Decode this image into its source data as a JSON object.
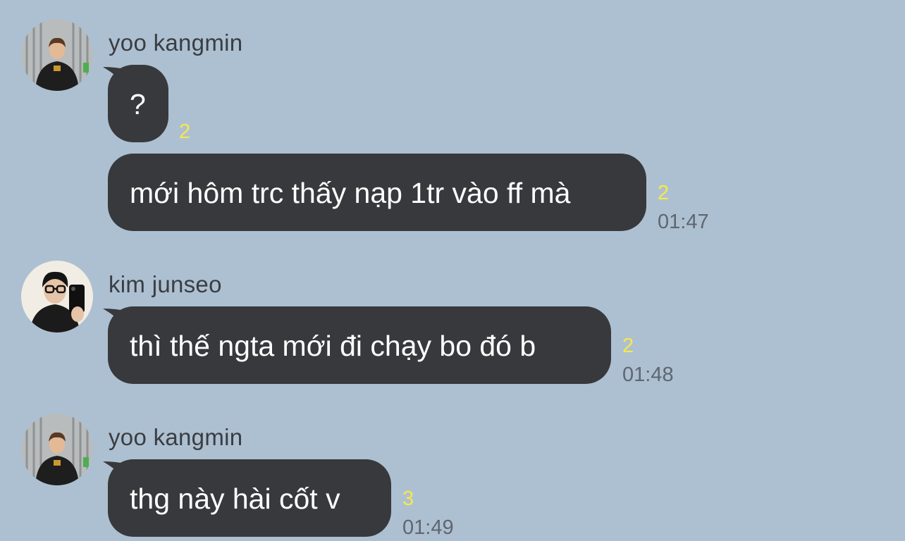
{
  "colors": {
    "background": "#adc0d1",
    "bubble": "#38393c",
    "bubble_text": "#ffffff",
    "unread": "#f7e84a",
    "time": "#5f6670",
    "sender": "#3a3d42"
  },
  "messages": [
    {
      "sender": "yoo kangmin",
      "avatar": "profile-photo",
      "bubbles": [
        {
          "text": "?",
          "unread": "2",
          "time": ""
        },
        {
          "text": "mới hôm trc thấy nạp 1tr vào ff mà",
          "unread": "2",
          "time": "01:47"
        }
      ]
    },
    {
      "sender": "kim junseo",
      "avatar": "profile-photo",
      "bubbles": [
        {
          "text": "thì thế ngta mới đi chạy bo đó b",
          "unread": "2",
          "time": "01:48"
        }
      ]
    },
    {
      "sender": "yoo kangmin",
      "avatar": "profile-photo",
      "bubbles": [
        {
          "text": "thg này hài cốt v",
          "unread": "3",
          "time": "01:49"
        }
      ]
    }
  ]
}
